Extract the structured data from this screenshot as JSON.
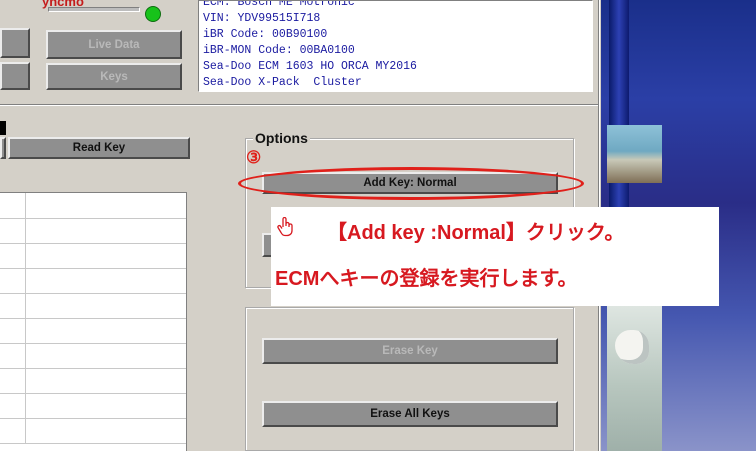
{
  "top_left": {
    "partial_label": "yncmo",
    "live_data_button": "Live Data",
    "keys_button": "Keys"
  },
  "info_lines": [
    "ECM: Bosch ME Motronic",
    "VIN: YDV99515I718",
    "iBR Code: 00B90100",
    "iBR-MON Code: 00BA0100",
    "Sea-Doo ECM 1603 HO ORCA MY2016",
    "Sea-Doo X-Pack  Cluster"
  ],
  "read_key_button": "Read Key",
  "options": {
    "legend": "Options",
    "step_marker": "③",
    "add_key_button": "Add Key: Normal"
  },
  "erase_key_button": "Erase Key",
  "erase_all_keys_button": "Erase All Keys",
  "overlay": {
    "line1": "【Add key :Normal】クリック。",
    "line2": "ECMへキーの登録を実行します。"
  },
  "colors": {
    "annotation_red": "#e0201a",
    "info_text": "#1a1aa0",
    "status_led": "#17c21a"
  }
}
